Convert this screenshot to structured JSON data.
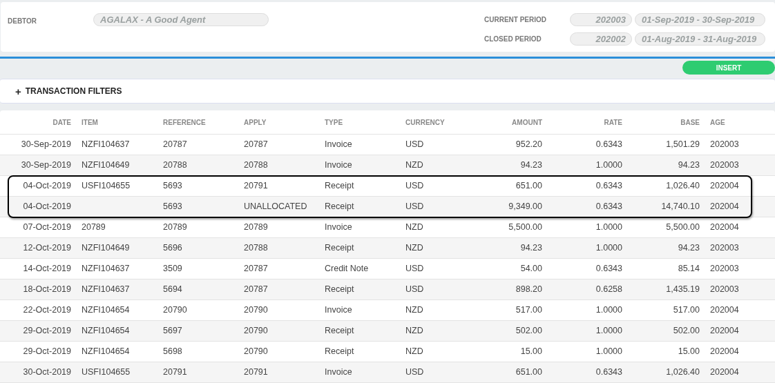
{
  "header": {
    "debtor": {
      "label": "DEBTOR",
      "value": "AGALAX - A Good Agent"
    },
    "periods": [
      {
        "label": "CURRENT PERIOD",
        "code": "202003",
        "range": "01-Sep-2019 - 30-Sep-2019"
      },
      {
        "label": "CLOSED PERIOD",
        "code": "202002",
        "range": "01-Aug-2019 - 31-Aug-2019"
      }
    ]
  },
  "insert_button": "INSERT",
  "filters": {
    "icon": "+",
    "label": "TRANSACTION FILTERS",
    "expanded": false
  },
  "table": {
    "columns": [
      "DATE",
      "ITEM",
      "REFERENCE",
      "APPLY",
      "TYPE",
      "CURRENCY",
      "AMOUNT",
      "RATE",
      "BASE",
      "AGE"
    ],
    "rows": [
      {
        "circled": false,
        "cells": [
          "30-Sep-2019",
          "NZFI104637",
          "20787",
          "20787",
          "Invoice",
          "USD",
          "952.20",
          "0.6343",
          "1,501.29",
          "202003"
        ]
      },
      {
        "circled": false,
        "cells": [
          "30-Sep-2019",
          "NZFI104649",
          "20788",
          "20788",
          "Invoice",
          "NZD",
          "94.23",
          "1.0000",
          "94.23",
          "202003"
        ]
      },
      {
        "circled": true,
        "cells": [
          "04-Oct-2019",
          "USFI104655",
          "5693",
          "20791",
          "Receipt",
          "USD",
          "651.00",
          "0.6343",
          "1,026.40",
          "202004"
        ]
      },
      {
        "circled": true,
        "cells": [
          "04-Oct-2019",
          "",
          "5693",
          "UNALLOCATED",
          "Receipt",
          "USD",
          "9,349.00",
          "0.6343",
          "14,740.10",
          "202004"
        ]
      },
      {
        "circled": false,
        "cells": [
          "07-Oct-2019",
          "20789",
          "20789",
          "20789",
          "Invoice",
          "NZD",
          "5,500.00",
          "1.0000",
          "5,500.00",
          "202004"
        ]
      },
      {
        "circled": false,
        "cells": [
          "12-Oct-2019",
          "NZFI104649",
          "5696",
          "20788",
          "Receipt",
          "NZD",
          "94.23",
          "1.0000",
          "94.23",
          "202003"
        ]
      },
      {
        "circled": false,
        "cells": [
          "14-Oct-2019",
          "NZFI104637",
          "3509",
          "20787",
          "Credit Note",
          "USD",
          "54.00",
          "0.6343",
          "85.14",
          "202003"
        ]
      },
      {
        "circled": false,
        "cells": [
          "18-Oct-2019",
          "NZFI104637",
          "5694",
          "20787",
          "Receipt",
          "USD",
          "898.20",
          "0.6258",
          "1,435.19",
          "202003"
        ]
      },
      {
        "circled": false,
        "cells": [
          "22-Oct-2019",
          "NZFI104654",
          "20790",
          "20790",
          "Invoice",
          "NZD",
          "517.00",
          "1.0000",
          "517.00",
          "202004"
        ]
      },
      {
        "circled": false,
        "cells": [
          "29-Oct-2019",
          "NZFI104654",
          "5697",
          "20790",
          "Receipt",
          "NZD",
          "502.00",
          "1.0000",
          "502.00",
          "202004"
        ]
      },
      {
        "circled": false,
        "cells": [
          "29-Oct-2019",
          "NZFI104654",
          "5698",
          "20790",
          "Receipt",
          "NZD",
          "15.00",
          "1.0000",
          "15.00",
          "202004"
        ]
      },
      {
        "circled": false,
        "cells": [
          "30-Oct-2019",
          "USFI104655",
          "20791",
          "20791",
          "Invoice",
          "USD",
          "651.00",
          "0.6343",
          "1,026.40",
          "202004"
        ]
      }
    ]
  }
}
